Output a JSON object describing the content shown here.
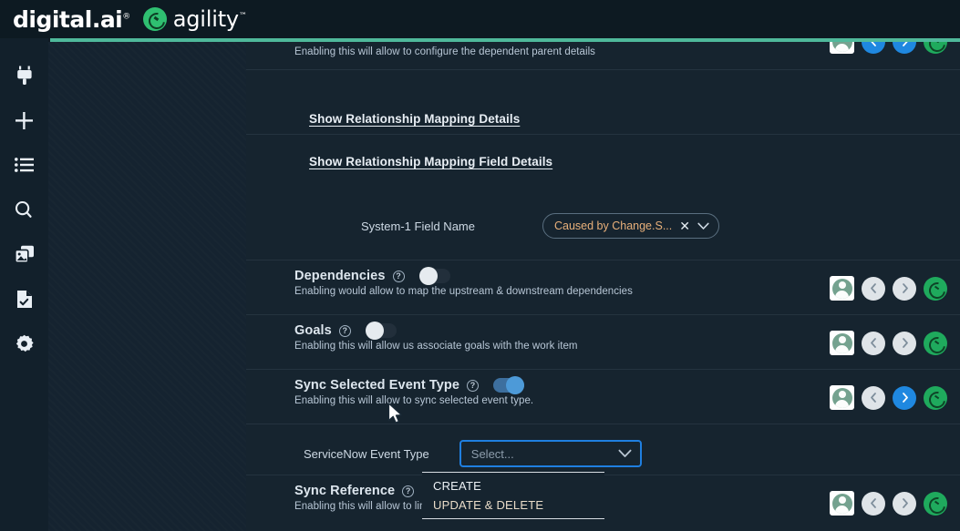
{
  "brand": {
    "product": "digital.ai",
    "product_tm": "®",
    "suite": "agility",
    "suite_tm": "™",
    "accent_green": "#4fb99b",
    "logo_green": "#2fbf71"
  },
  "sidebar": {
    "items": [
      {
        "name": "plug-icon",
        "label": "Connectors"
      },
      {
        "name": "plus-icon",
        "label": "Add"
      },
      {
        "name": "list-icon",
        "label": "List"
      },
      {
        "name": "search-icon",
        "label": "Search"
      },
      {
        "name": "copy-icon",
        "label": "Templates"
      },
      {
        "name": "document-check-icon",
        "label": "Reports"
      },
      {
        "name": "gear-icon",
        "label": "Settings"
      }
    ]
  },
  "rows": {
    "partial_top": {
      "description": "Enabling this will allow to configure the dependent parent details",
      "sync_left_active": true,
      "sync_right_active": true
    },
    "link_1": {
      "label": "Show Relationship Mapping Details"
    },
    "link_2": {
      "label": "Show Relationship Mapping Field Details"
    },
    "field_mapping": {
      "label": "System-1 Field Name",
      "value": "Caused by Change.S...",
      "clear_glyph": "✕",
      "chevron_glyph": "⌄"
    },
    "dependencies": {
      "title": "Dependencies",
      "help_glyph": "?",
      "description": "Enabling would allow to map the upstream & downstream dependencies",
      "toggle_state": "off",
      "sync_left_active": false,
      "sync_right_active": false
    },
    "goals": {
      "title": "Goals",
      "help_glyph": "?",
      "description": "Enabling this will allow us associate goals with the work item",
      "toggle_state": "off",
      "sync_left_active": false,
      "sync_right_active": false
    },
    "sync_selected_event_type": {
      "title": "Sync Selected Event Type",
      "help_glyph": "?",
      "description": "Enabling this will allow to sync selected event type.",
      "toggle_state": "on",
      "sync_left_active": false,
      "sync_right_active": true
    },
    "servicenow_event_type": {
      "label": "ServiceNow Event Type",
      "placeholder": "Select...",
      "value": "",
      "focused": true,
      "chevron_glyph": "⌄",
      "options": [
        "CREATE",
        "UPDATE & DELETE"
      ]
    },
    "sync_reference": {
      "title": "Sync Reference",
      "help_glyph": "?",
      "description": "Enabling this will allow to link source",
      "toggle_state": "off",
      "sync_left_active": false,
      "sync_right_active": false
    }
  },
  "icon_labels": {
    "avatar": "user-avatar",
    "left": "chevron-left-sync",
    "right": "chevron-right-sync",
    "logo": "agility-logo"
  }
}
